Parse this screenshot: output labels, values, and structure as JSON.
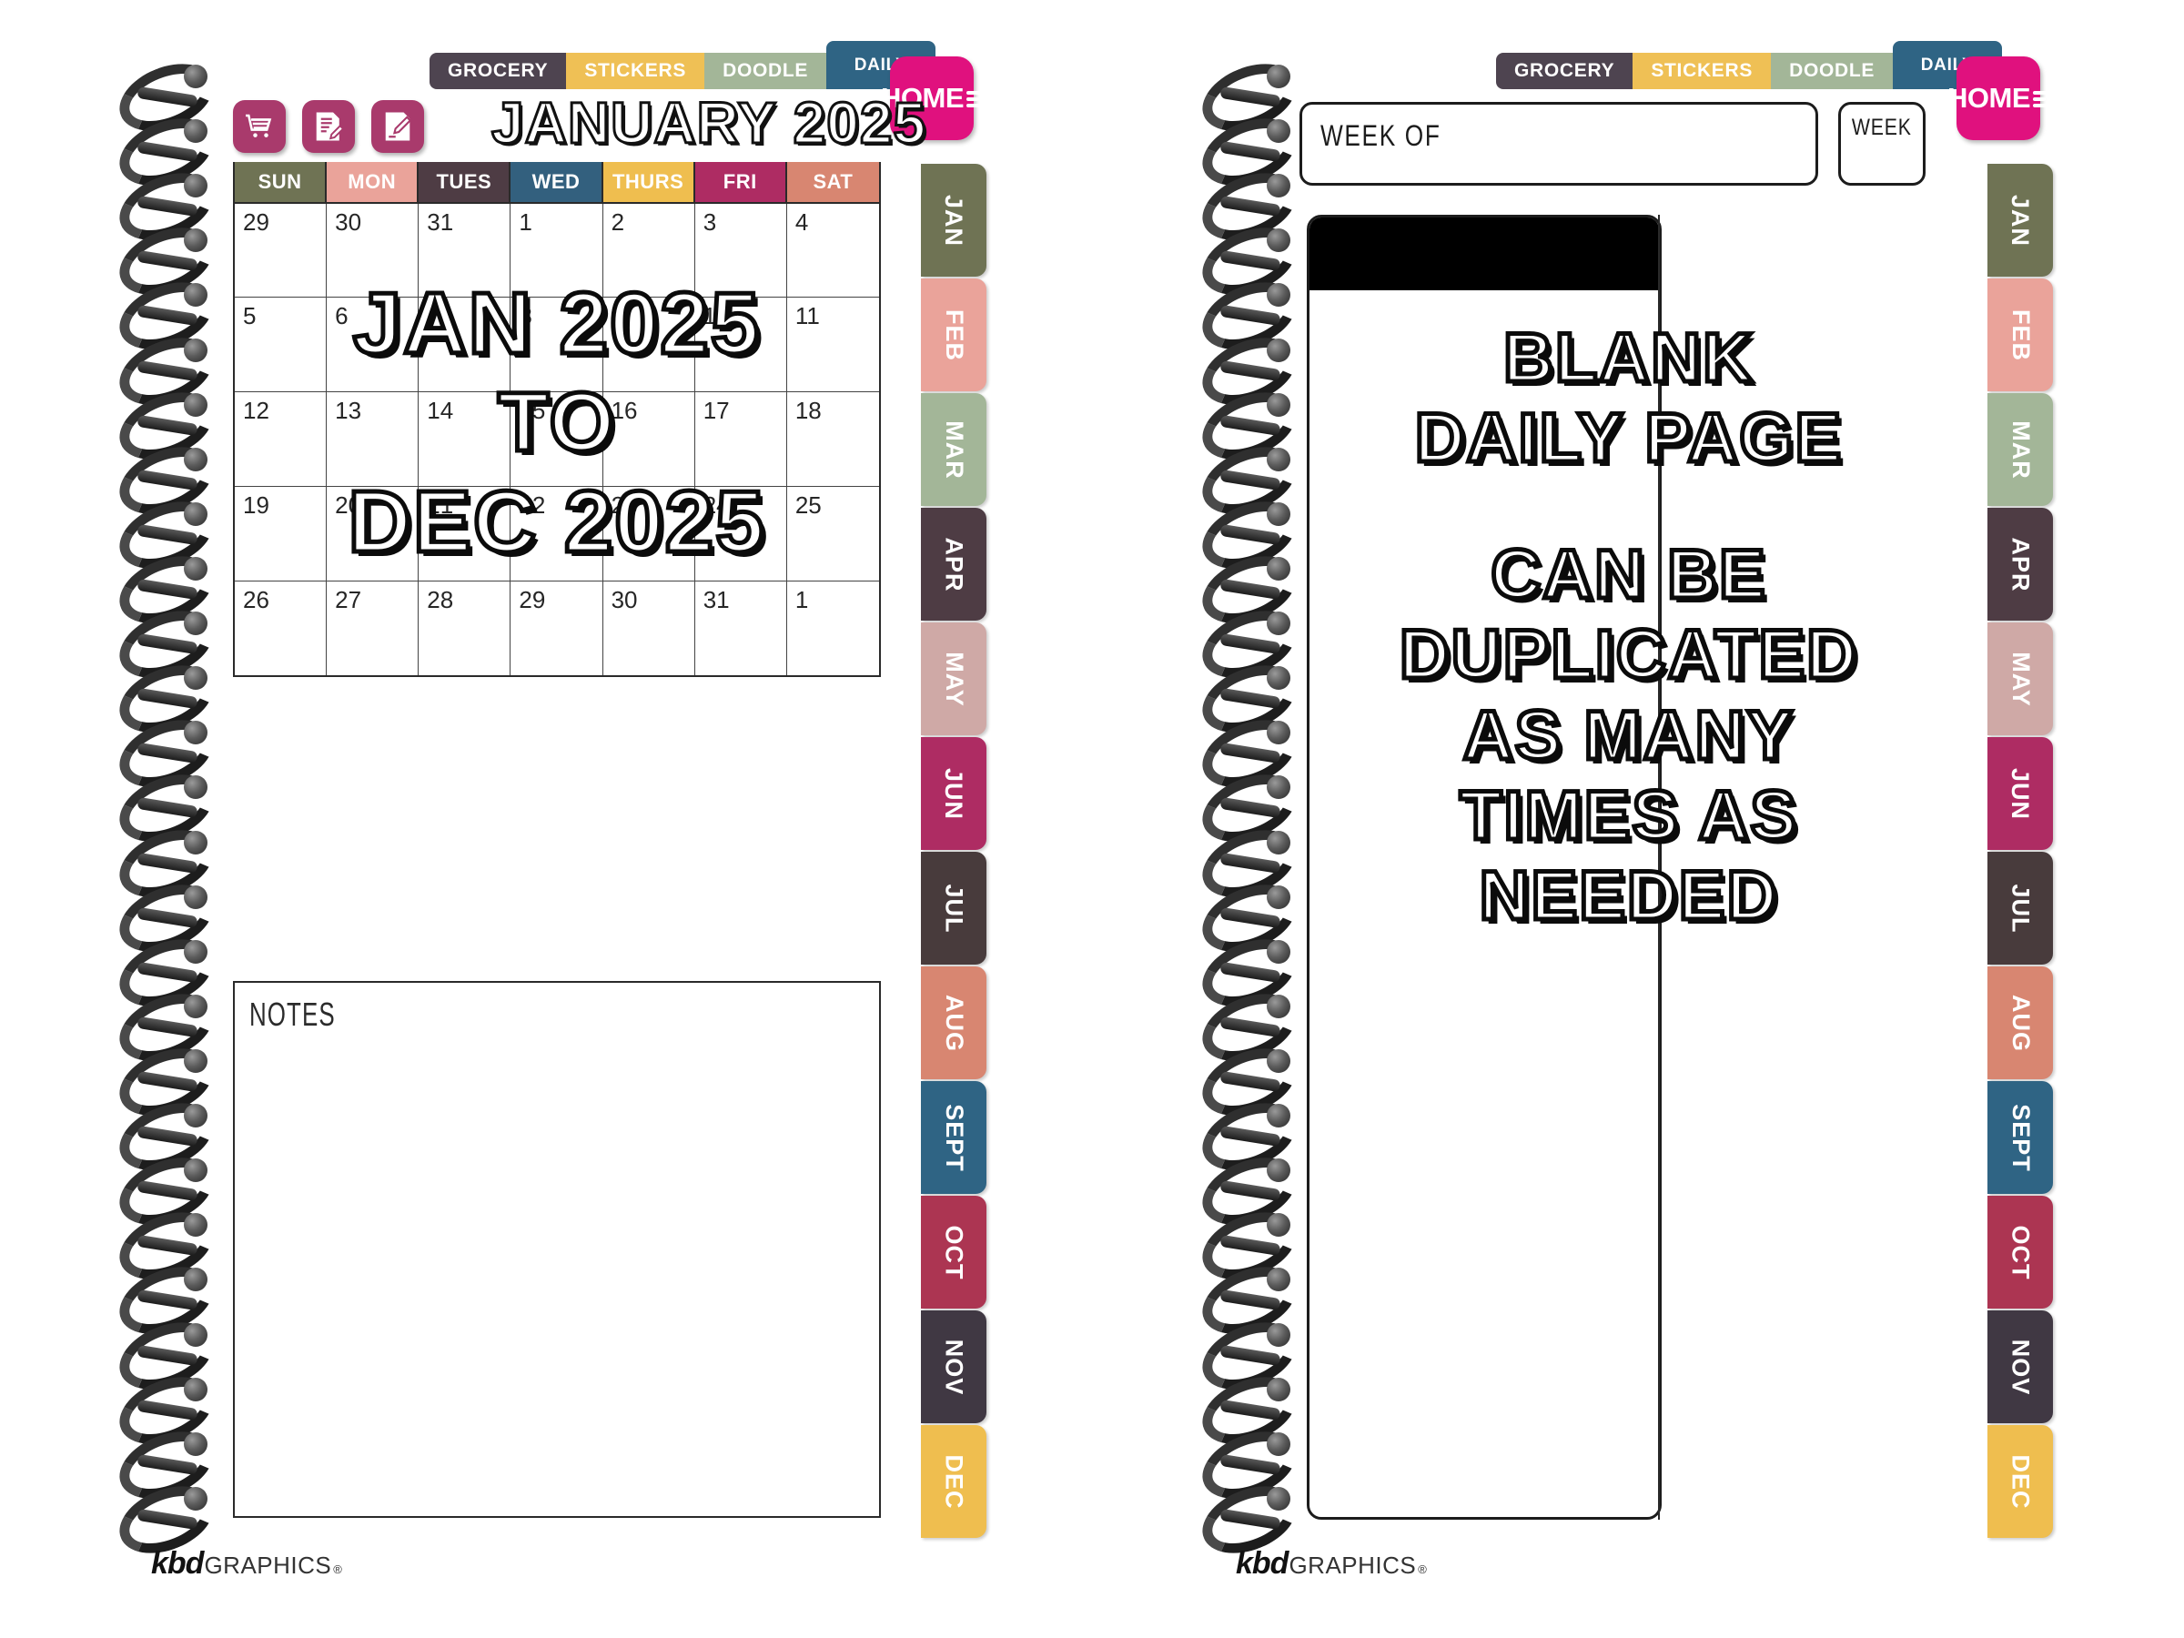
{
  "category_tabs": [
    {
      "label": "GROCERY",
      "color": "#4e4450",
      "raised": false
    },
    {
      "label": "STICKERS",
      "color": "#efc055",
      "raised": false
    },
    {
      "label": "DOODLE",
      "color": "#a3b698",
      "raised": false
    },
    {
      "label": "DAILY",
      "color": "#2f6484",
      "raised": true
    }
  ],
  "home_button": {
    "label": "HOME",
    "color": "#e0117e"
  },
  "action_icons": [
    {
      "name": "grocery-cart-icon"
    },
    {
      "name": "checklist-note-icon"
    },
    {
      "name": "edit-note-icon"
    }
  ],
  "left_page": {
    "month_title": "JANUARY 2025",
    "day_headers": [
      {
        "label": "SUN",
        "color": "#6f7354"
      },
      {
        "label": "MON",
        "color": "#eaa39a"
      },
      {
        "label": "TUES",
        "color": "#4e3c44"
      },
      {
        "label": "WED",
        "color": "#33607e"
      },
      {
        "label": "THURS",
        "color": "#efbe4f"
      },
      {
        "label": "FRI",
        "color": "#ae2c63"
      },
      {
        "label": "SAT",
        "color": "#d88671"
      }
    ],
    "weeks": [
      [
        "29",
        "30",
        "31",
        "1",
        "2",
        "3",
        "4"
      ],
      [
        "5",
        "6",
        "7",
        "8",
        "9",
        "10",
        "11"
      ],
      [
        "12",
        "13",
        "14",
        "15",
        "16",
        "17",
        "18"
      ],
      [
        "19",
        "20",
        "21",
        "22",
        "23",
        "24",
        "25"
      ],
      [
        "26",
        "27",
        "28",
        "29",
        "30",
        "31",
        "1"
      ]
    ],
    "overlay_lines": [
      "JAN 2025",
      "TO",
      "DEC 2025"
    ],
    "notes_label": "NOTES"
  },
  "right_page": {
    "week_of_label": "WEEK OF",
    "week_of_value": "",
    "week_number_label": "WEEK",
    "week_number_value": "",
    "overlay_block_1": [
      "BLANK",
      "DAILY PAGE"
    ],
    "overlay_block_2": [
      "CAN BE",
      "DUPLICATED",
      "AS MANY",
      "TIMES AS",
      "NEEDED"
    ]
  },
  "month_tabs": [
    {
      "label": "JAN",
      "color": "#6f7354"
    },
    {
      "label": "FEB",
      "color": "#eaa39a"
    },
    {
      "label": "MAR",
      "color": "#a3b698"
    },
    {
      "label": "APR",
      "color": "#4e3c44"
    },
    {
      "label": "MAY",
      "color": "#cfa9a6"
    },
    {
      "label": "JUN",
      "color": "#ae2c63"
    },
    {
      "label": "JUL",
      "color": "#483b3c"
    },
    {
      "label": "AUG",
      "color": "#d88671"
    },
    {
      "label": "SEPT",
      "color": "#2f6484"
    },
    {
      "label": "OCT",
      "color": "#ac3552"
    },
    {
      "label": "NOV",
      "color": "#403843"
    },
    {
      "label": "DEC",
      "color": "#efbe4f"
    }
  ],
  "footer": {
    "brand_bold": "kbd",
    "brand_light": "GRAPHICS",
    "registered": "®"
  }
}
